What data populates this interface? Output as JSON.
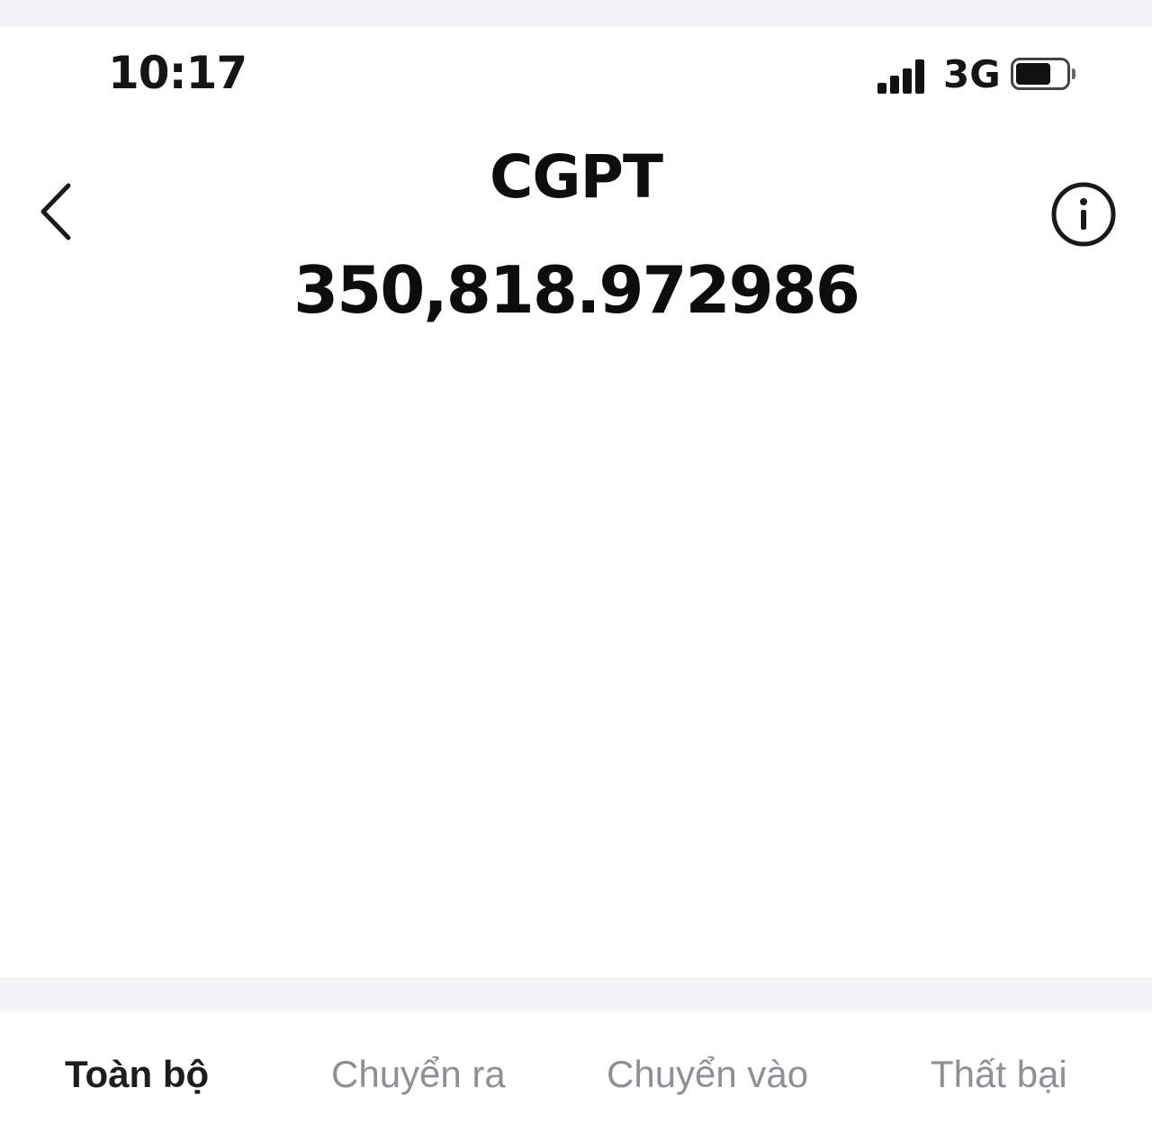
{
  "status_bar": {
    "time": "10:17",
    "network": "3G",
    "icons": [
      "signal-icon",
      "battery-icon"
    ],
    "signal_bars": 4,
    "battery_level": 0.6
  },
  "header": {
    "coin_name": "CGPT",
    "balance": "350,818.972986",
    "icons": [
      "back-chevron-icon",
      "info-icon"
    ]
  },
  "tabs": [
    {
      "label": "Toàn bộ",
      "active": true
    },
    {
      "label": "Chuyển ra",
      "active": false
    },
    {
      "label": "Chuyển vào",
      "active": false
    },
    {
      "label": "Thất bại",
      "active": false
    }
  ],
  "colors": {
    "background": "#ffffff",
    "separator": "#f4f3f7",
    "text_primary": "#0d0d0d",
    "tab_inactive": "#8f8f96"
  }
}
